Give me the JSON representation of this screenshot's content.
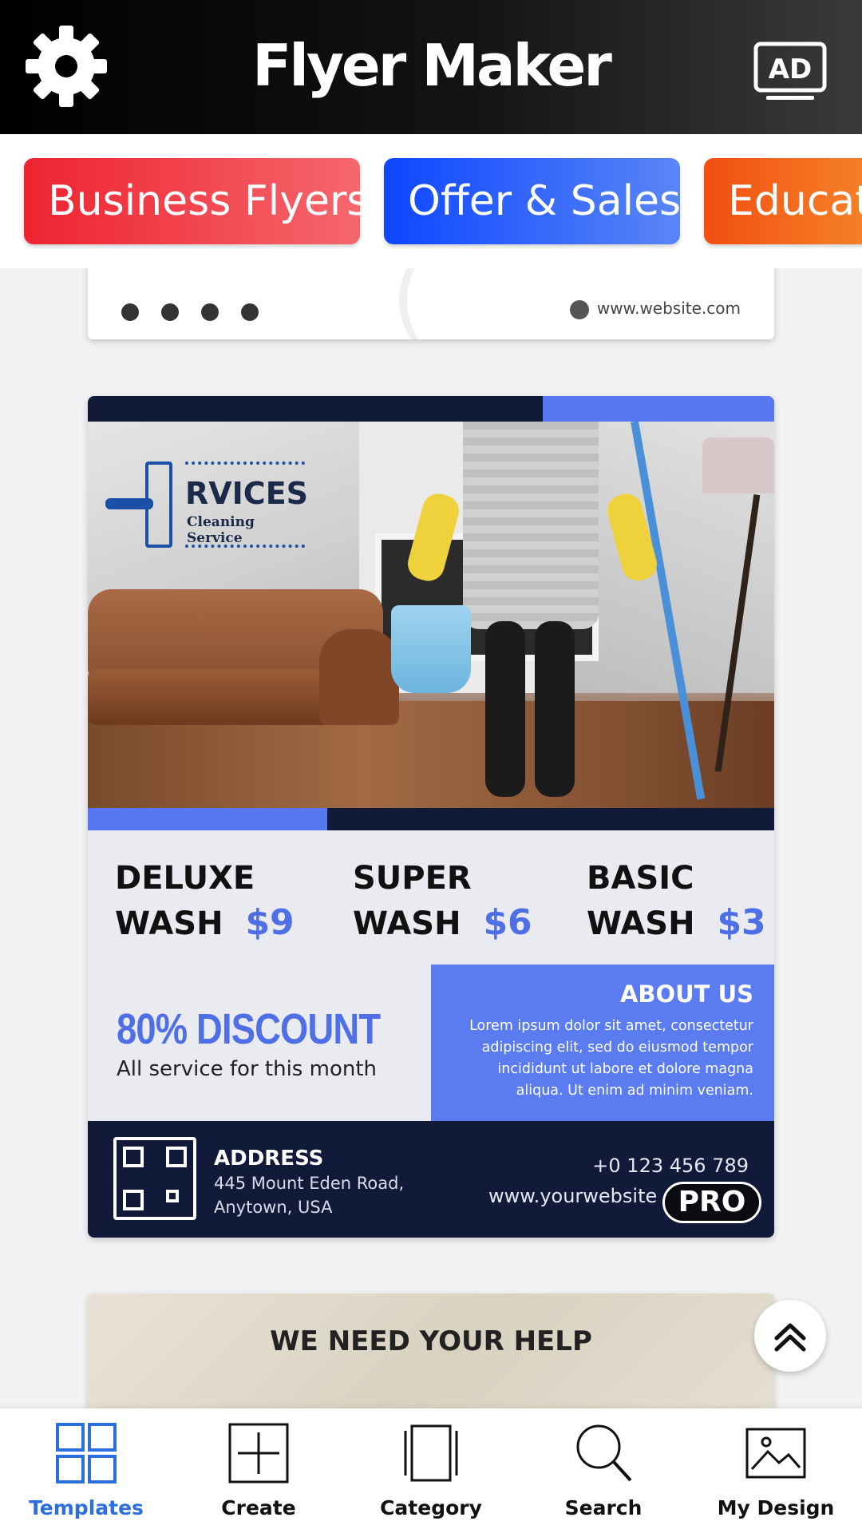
{
  "header": {
    "title": "Flyer Maker",
    "ad_label": "AD"
  },
  "categories": [
    {
      "label": "Business Flyers",
      "color": "#ee2330"
    },
    {
      "label": "Offer & Sales",
      "color": "#0d47ff"
    },
    {
      "label": "Educat",
      "color": "#f24f10"
    }
  ],
  "templates": {
    "card1": {
      "website": "www.website.com"
    },
    "card2": {
      "logo_title": "RVICES",
      "logo_subtitle": "Cleaning Service",
      "prices": [
        {
          "line1": "DELUXE",
          "line2": "WASH",
          "amount": "$9"
        },
        {
          "line1": "SUPER",
          "line2": "WASH",
          "amount": "$6"
        },
        {
          "line1": "BASIC",
          "line2": "WASH",
          "amount": "$3"
        }
      ],
      "discount": "80% DISCOUNT",
      "discount_sub": "All service for this month",
      "about_title": "ABOUT US",
      "about_lines": [
        "Lorem ipsum dolor sit amet, consectetur",
        "adipiscing elit, sed do eiusmod tempor",
        "incididunt ut labore et dolore magna",
        "aliqua. Ut enim ad minim veniam."
      ],
      "address_title": "ADDRESS",
      "address_line1": "445 Mount Eden Road,",
      "address_line2": "Anytown, USA",
      "phone": "+0 123 456 789",
      "website": "www.yourwebsite",
      "badge": "PRO",
      "accent": "#5778ee",
      "navy": "#121a3a"
    },
    "card3": {
      "headline": "WE NEED YOUR HELP"
    }
  },
  "nav": [
    {
      "label": "Templates",
      "icon": "templates-grid-icon",
      "active": true
    },
    {
      "label": "Create",
      "icon": "create-plus-icon",
      "active": false
    },
    {
      "label": "Category",
      "icon": "category-layers-icon",
      "active": false
    },
    {
      "label": "Search",
      "icon": "search-icon",
      "active": false
    },
    {
      "label": "My Design",
      "icon": "image-icon",
      "active": false
    }
  ],
  "colors": {
    "active_nav": "#2e6fe0"
  }
}
